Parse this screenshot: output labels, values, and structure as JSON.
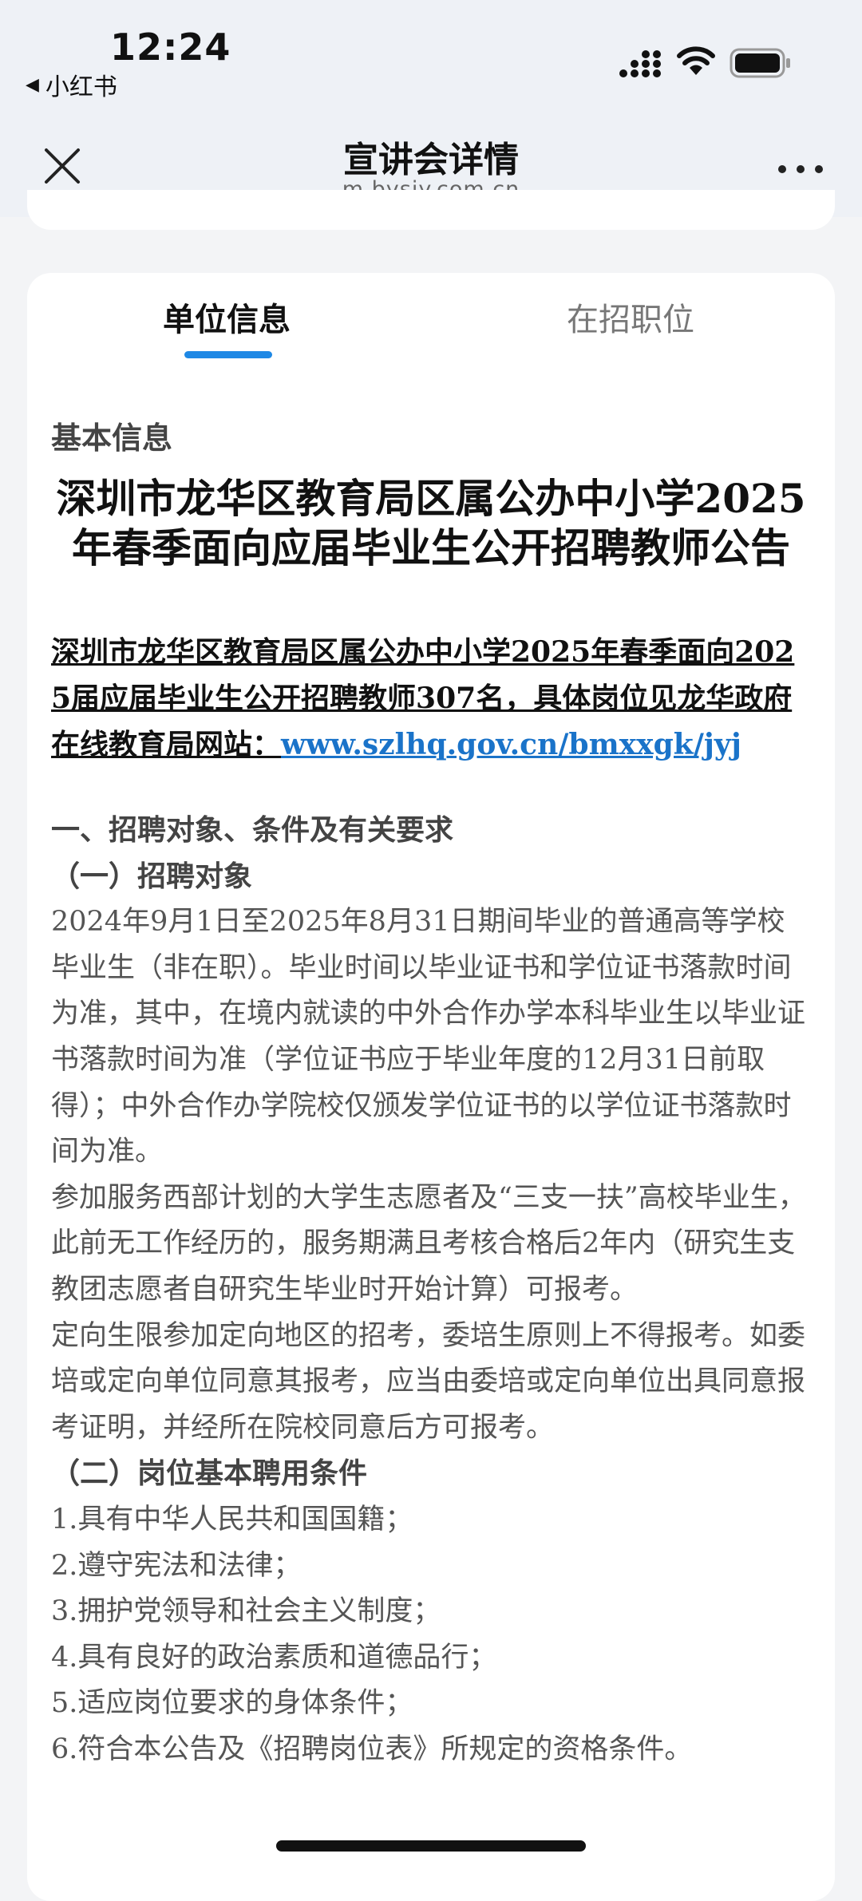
{
  "status_bar": {
    "time": "12:24",
    "back_app": "小红书",
    "icons": [
      "signal-icon",
      "wifi-icon",
      "battery-icon"
    ]
  },
  "header": {
    "title": "宣讲会详情",
    "subtitle": "m.bysjy.com.cn",
    "left_icon": "close-icon",
    "right_icon": "more-icon"
  },
  "tabs": [
    {
      "label": "单位信息",
      "active": true
    },
    {
      "label": "在招职位",
      "active": false
    }
  ],
  "colors": {
    "accent": "#1e88e5",
    "link": "#1a73c9",
    "background": "#f3f4f6"
  },
  "content": {
    "section_label": "基本信息",
    "title": "深圳市龙华区教育局区属公办中小学2025年春季面向应届毕业生公开招聘教师公告",
    "intro_text": "深圳市龙华区教育局区属公办中小学2025年春季面向2025届应届毕业生公开招聘教师307名，具体岗位见龙华政府在线教育局网站：",
    "intro_link": "www.szlhq.gov.cn/bmxxgk/jyj",
    "heading_1": "一、招聘对象、条件及有关要求",
    "subheading_1": "（一）招聘对象",
    "para_1": "2024年9月1日至2025年8月31日期间毕业的普通高等学校毕业生（非在职）。毕业时间以毕业证书和学位证书落款时间为准，其中，在境内就读的中外合作办学本科毕业生以毕业证书落款时间为准（学位证书应于毕业年度的12月31日前取得）；中外合作办学院校仅颁发学位证书的以学位证书落款时间为准。",
    "para_2": "参加服务西部计划的大学生志愿者及“三支一扶”高校毕业生，此前无工作经历的，服务期满且考核合格后2年内（研究生支教团志愿者自研究生毕业时开始计算）可报考。",
    "para_3": "定向生限参加定向地区的招考，委培生原则上不得报考。如委培或定向单位同意其报考，应当由委培或定向单位出具同意报考证明，并经所在院校同意后方可报考。",
    "subheading_2": "（二）岗位基本聘用条件",
    "conditions": [
      "1.具有中华人民共和国国籍；",
      "2.遵守宪法和法律；",
      "3.拥护党领导和社会主义制度；",
      "4.具有良好的政治素质和道德品行；",
      "5.适应岗位要求的身体条件；",
      "6.符合本公告及《招聘岗位表》所规定的资格条件。"
    ]
  }
}
